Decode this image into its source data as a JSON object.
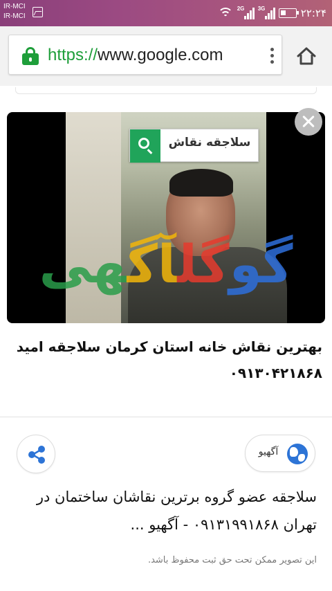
{
  "status_bar": {
    "carrier_1": "IR-MCI",
    "carrier_2": "IR-MCI",
    "network_1": "2G",
    "network_2": "3G",
    "time": "۲۲:۲۴"
  },
  "browser": {
    "url_scheme": "https://",
    "url_host": "www.google.com",
    "secure_color": "#1e9e3a"
  },
  "card": {
    "search_chip_text": "سلاجقه نقاش",
    "brand_parts": [
      "گو",
      "گل",
      "آگ",
      "هی"
    ],
    "title": "بهترین نقاش خانه استان کرمان سلاجقه امید ۰۹۱۳۰۴۲۱۸۶۸"
  },
  "result": {
    "source_name": "آگهیو",
    "description": "سلاجقه عضو گروه برترین نقاشان ساختمان در تهران ۰۹۱۳۱۹۹۱۸۶۸ - آگهیو ...",
    "copyright": "این تصویر ممکن تحت حق ثبت محفوظ باشد."
  },
  "icons": {
    "lock": "lock-icon",
    "menu": "more-vert-icon",
    "home": "home-icon",
    "close": "close-icon",
    "share": "share-icon",
    "globe": "globe-icon",
    "search": "search-icon"
  }
}
